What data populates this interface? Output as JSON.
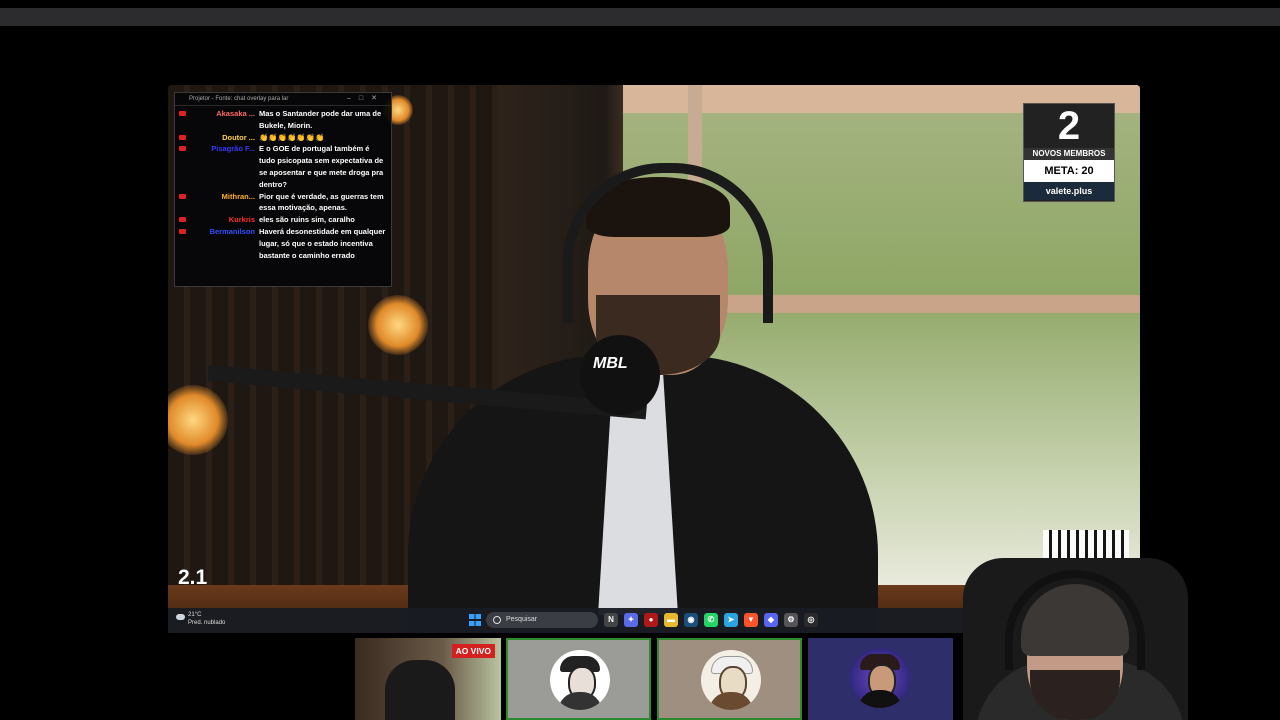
{
  "chat": {
    "title": "Projetor - Fonte: chat overlay para lar",
    "messages": [
      {
        "user": "Akasaka ...",
        "user_color": "#ff6a6a",
        "text": "Mas o Santander pode dar uma de Bukele, Miorin."
      },
      {
        "user": "Doutor ...",
        "user_color": "#ffd23c",
        "text": "👏👏👏👏👏👏👏"
      },
      {
        "user": "Pisagrão F...",
        "user_color": "#3a3aff",
        "text": "E o GOE de portugal também é tudo psicopata sem expectativa de se aposentar e que mete droga pra dentro?"
      },
      {
        "user": "Mithran...",
        "user_color": "#ffb030",
        "text": "Pior que é verdade, as guerras tem essa motivação, apenas."
      },
      {
        "user": "Kurkris",
        "user_color": "#ff3030",
        "text": "eles são ruins sim, caralho"
      },
      {
        "user": "Bermanilson",
        "user_color": "#3050ff",
        "text": "Haverá desonestidade em qualquer lugar, só que o estado incentiva bastante o caminho errado"
      }
    ]
  },
  "sub_widget": {
    "count": "2",
    "label": "NOVOS MEMBROS",
    "meta": "META: 20",
    "site": "valete.plus"
  },
  "mic_logo": "MBL",
  "overlay_number": "2.1",
  "taskbar": {
    "weather_temp": "21°C",
    "weather_desc": "Pred. nublado",
    "search_placeholder": "Pesquisar",
    "apps": [
      {
        "name": "news-app-icon",
        "glyph": "N",
        "color": "#444444"
      },
      {
        "name": "copilot-icon",
        "glyph": "✦",
        "color": "#5a6be8"
      },
      {
        "name": "record-app-icon",
        "glyph": "●",
        "color": "#b01818"
      },
      {
        "name": "file-explorer-icon",
        "glyph": "▬",
        "color": "#e8b830"
      },
      {
        "name": "steam-icon",
        "glyph": "◉",
        "color": "#1b4e7a"
      },
      {
        "name": "whatsapp-icon",
        "glyph": "✆",
        "color": "#25d366"
      },
      {
        "name": "telegram-icon",
        "glyph": "➤",
        "color": "#2aa3e0"
      },
      {
        "name": "brave-icon",
        "glyph": "▼",
        "color": "#fb542b"
      },
      {
        "name": "discord-icon",
        "glyph": "◆",
        "color": "#5865f2"
      },
      {
        "name": "settings-icon",
        "glyph": "⚙",
        "color": "#555555"
      },
      {
        "name": "obs-icon",
        "glyph": "◎",
        "color": "#2a2a2a"
      }
    ]
  },
  "thumbnails": [
    {
      "badge": "AO VIVO"
    }
  ]
}
